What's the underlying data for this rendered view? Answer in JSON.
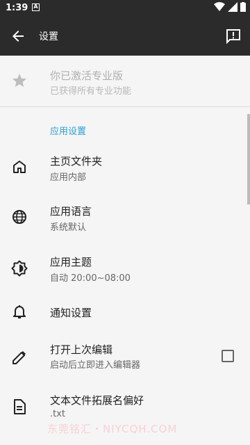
{
  "status": {
    "time": "1:39",
    "notif_glyph": "A"
  },
  "appbar": {
    "title": "设置"
  },
  "pro": {
    "title": "你已激活专业版",
    "subtitle": "已获得所有专业功能"
  },
  "section": "应用设置",
  "items": [
    {
      "title": "主页文件夹",
      "subtitle": "应用内部",
      "icon": "home-icon"
    },
    {
      "title": "应用语言",
      "subtitle": "系统默认",
      "icon": "globe-icon"
    },
    {
      "title": "应用主题",
      "subtitle": "自动 20:00~08:00",
      "icon": "brightness-icon"
    },
    {
      "title": "通知设置",
      "subtitle": "",
      "icon": "bell-icon"
    },
    {
      "title": "打开上次编辑",
      "subtitle": "启动后立即进入编辑器",
      "icon": "pencil-icon",
      "checked": false
    },
    {
      "title": "文本文件拓展名偏好",
      "subtitle": ".txt",
      "icon": "file-icon"
    }
  ],
  "watermark": "东莞铭汇・NIYCQH.COM",
  "colors": {
    "bar": "#2b2b2b",
    "accent": "#2a9fd8",
    "bg": "#f5f5f5"
  }
}
